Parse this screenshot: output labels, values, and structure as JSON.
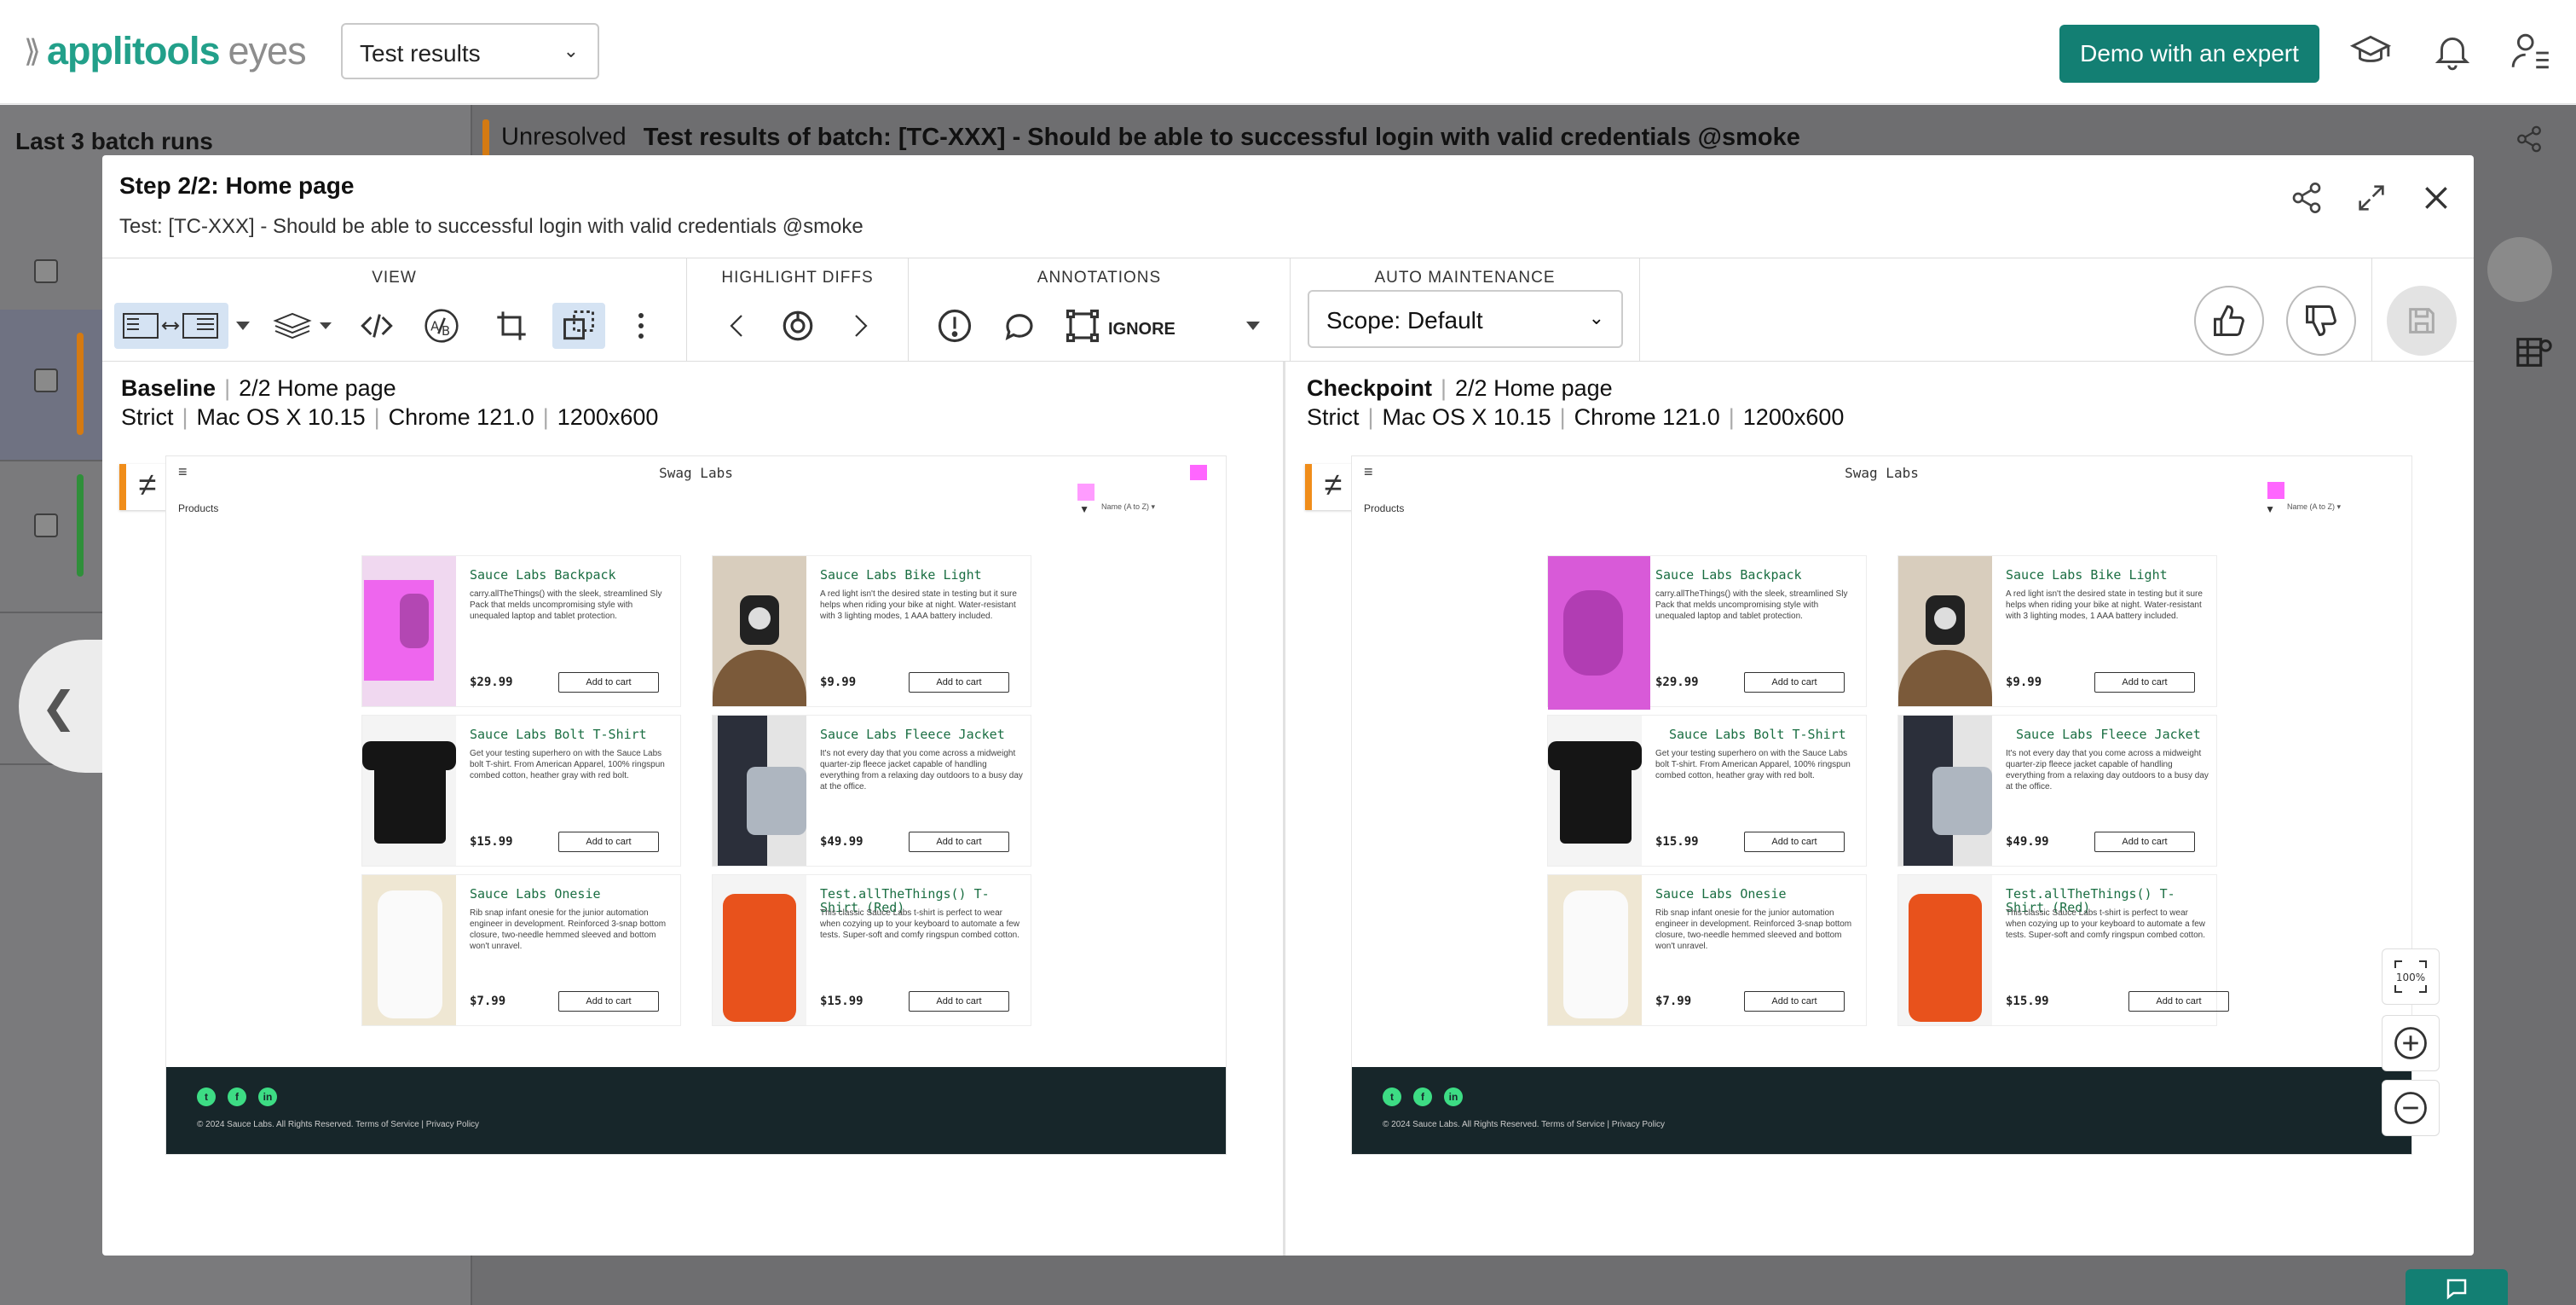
{
  "app": {
    "logo_a": "applitools",
    "logo_b": "eyes",
    "selector_value": "Test results",
    "demo_label": "Demo with an expert"
  },
  "background": {
    "panel_title": "Last 3 batch runs",
    "header_status": "Unresolved",
    "header_title": "Test results of batch:  [TC-XXX] - Should be able to successful login with valid credentials @smoke"
  },
  "modal": {
    "title": "Step 2/2:  Home page",
    "subtitle": "Test: [TC-XXX] - Should be able to successful login with valid credentials @smoke",
    "sections": {
      "view": "VIEW",
      "highlight": "HIGHLIGHT DIFFS",
      "annotations": "ANNOTATIONS",
      "auto": "AUTO MAINTENANCE"
    },
    "ignore_label": "IGNORE",
    "scope_value": "Scope: Default"
  },
  "baseline": {
    "label": "Baseline",
    "step": "2/2 Home page",
    "match": "Strict",
    "os": "Mac OS X 10.15",
    "browser": "Chrome 121.0",
    "size": "1200x600"
  },
  "checkpoint": {
    "label": "Checkpoint",
    "step": "2/2 Home page",
    "match": "Strict",
    "os": "Mac OS X 10.15",
    "browser": "Chrome 121.0",
    "size": "1200x600"
  },
  "site": {
    "title": "Swag Labs",
    "products": "Products",
    "sort": "Name (A to Z)",
    "add": "Add to cart",
    "footer": "© 2024 Sauce Labs. All Rights Reserved. Terms of Service | Privacy Policy",
    "items": [
      {
        "name": "Sauce Labs Backpack",
        "desc": "carry.allTheThings() with the sleek, streamlined Sly Pack that melds uncompromising style with unequaled laptop and tablet protection.",
        "price": "$29.99"
      },
      {
        "name": "Sauce Labs Bike Light",
        "desc": "A red light isn't the desired state in testing but it sure helps when riding your bike at night. Water-resistant with 3 lighting modes, 1 AAA battery included.",
        "price": "$9.99"
      },
      {
        "name": "Sauce Labs Bolt T-Shirt",
        "desc": "Get your testing superhero on with the Sauce Labs bolt T-shirt. From American Apparel, 100% ringspun combed cotton, heather gray with red bolt.",
        "price": "$15.99"
      },
      {
        "name": "Sauce Labs Fleece Jacket",
        "desc": "It's not every day that you come across a midweight quarter-zip fleece jacket capable of handling everything from a relaxing day outdoors to a busy day at the office.",
        "price": "$49.99"
      },
      {
        "name": "Sauce Labs Onesie",
        "desc": "Rib snap infant onesie for the junior automation engineer in development. Reinforced 3-snap bottom closure, two-needle hemmed sleeved and bottom won't unravel.",
        "price": "$7.99"
      },
      {
        "name": "Test.allTheThings() T-Shirt (Red)",
        "desc": "This classic Sauce Labs t-shirt is perfect to wear when cozying up to your keyboard to automate a few tests. Super-soft and comfy ringspun combed cotton.",
        "price": "$15.99"
      }
    ]
  },
  "zoom_label": "100%",
  "colors": {
    "brand": "#22a08a",
    "demo": "#137f73",
    "diff": "#ff66ff",
    "stripe": "#f08d1a"
  }
}
